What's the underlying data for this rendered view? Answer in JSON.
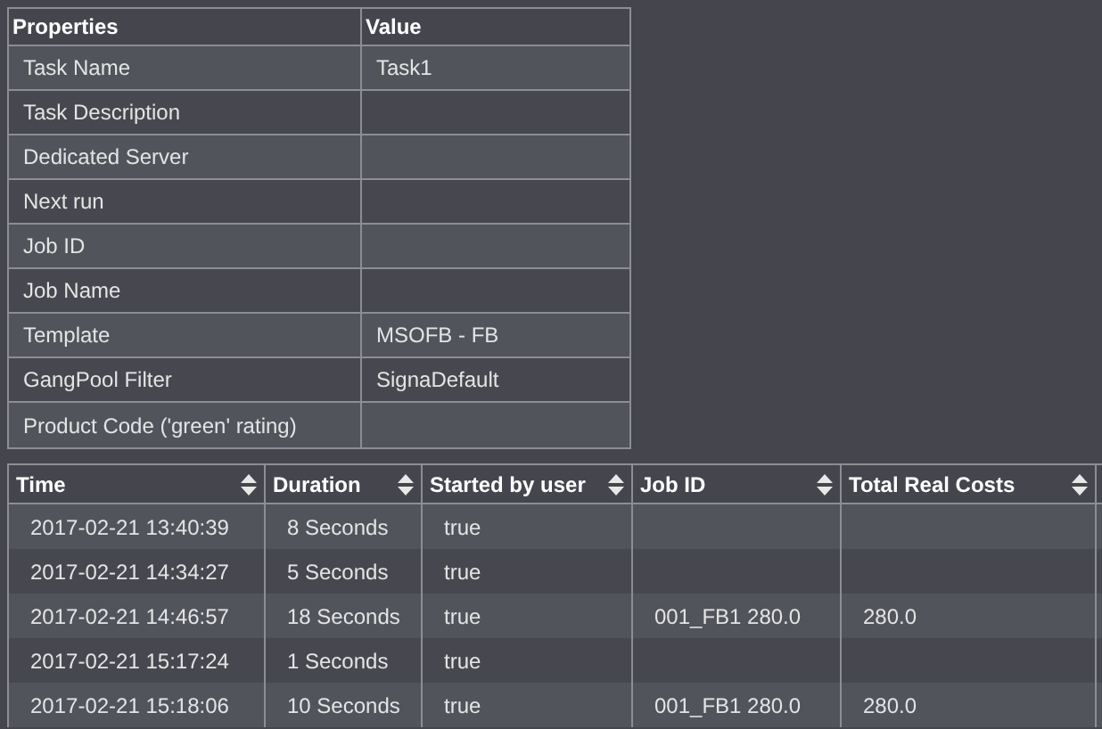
{
  "properties_table": {
    "columns": [
      "Properties",
      "Value"
    ],
    "rows": [
      {
        "property": "Task Name",
        "value": "Task1"
      },
      {
        "property": "Task Description"
      },
      {
        "property": "Dedicated Server"
      },
      {
        "property": "Next run"
      },
      {
        "property": "Job ID"
      },
      {
        "property": "Job Name"
      },
      {
        "property": "Template",
        "value": "MSOFB - FB"
      },
      {
        "property": "GangPool Filter",
        "value": "SignaDefault"
      },
      {
        "property": "Product Code ('green' rating)"
      }
    ]
  },
  "runs_table": {
    "columns": [
      "Time",
      "Duration",
      "Started by user",
      "Job ID",
      "Total Real Costs"
    ],
    "rows": [
      [
        "2017-02-21 13:40:39",
        "8 Seconds",
        "true",
        null,
        null
      ],
      [
        "2017-02-21 14:34:27",
        "5 Seconds",
        "true",
        null,
        null
      ],
      [
        "2017-02-21 14:46:57",
        "18 Seconds",
        "true",
        "001_FB1 280.0",
        "280.0"
      ],
      [
        "2017-02-21 15:17:24",
        "1 Seconds",
        "true",
        null,
        null
      ],
      [
        "2017-02-21 15:18:06",
        "10 Seconds",
        "true",
        "001_FB1 280.0",
        "280.0"
      ]
    ]
  }
}
